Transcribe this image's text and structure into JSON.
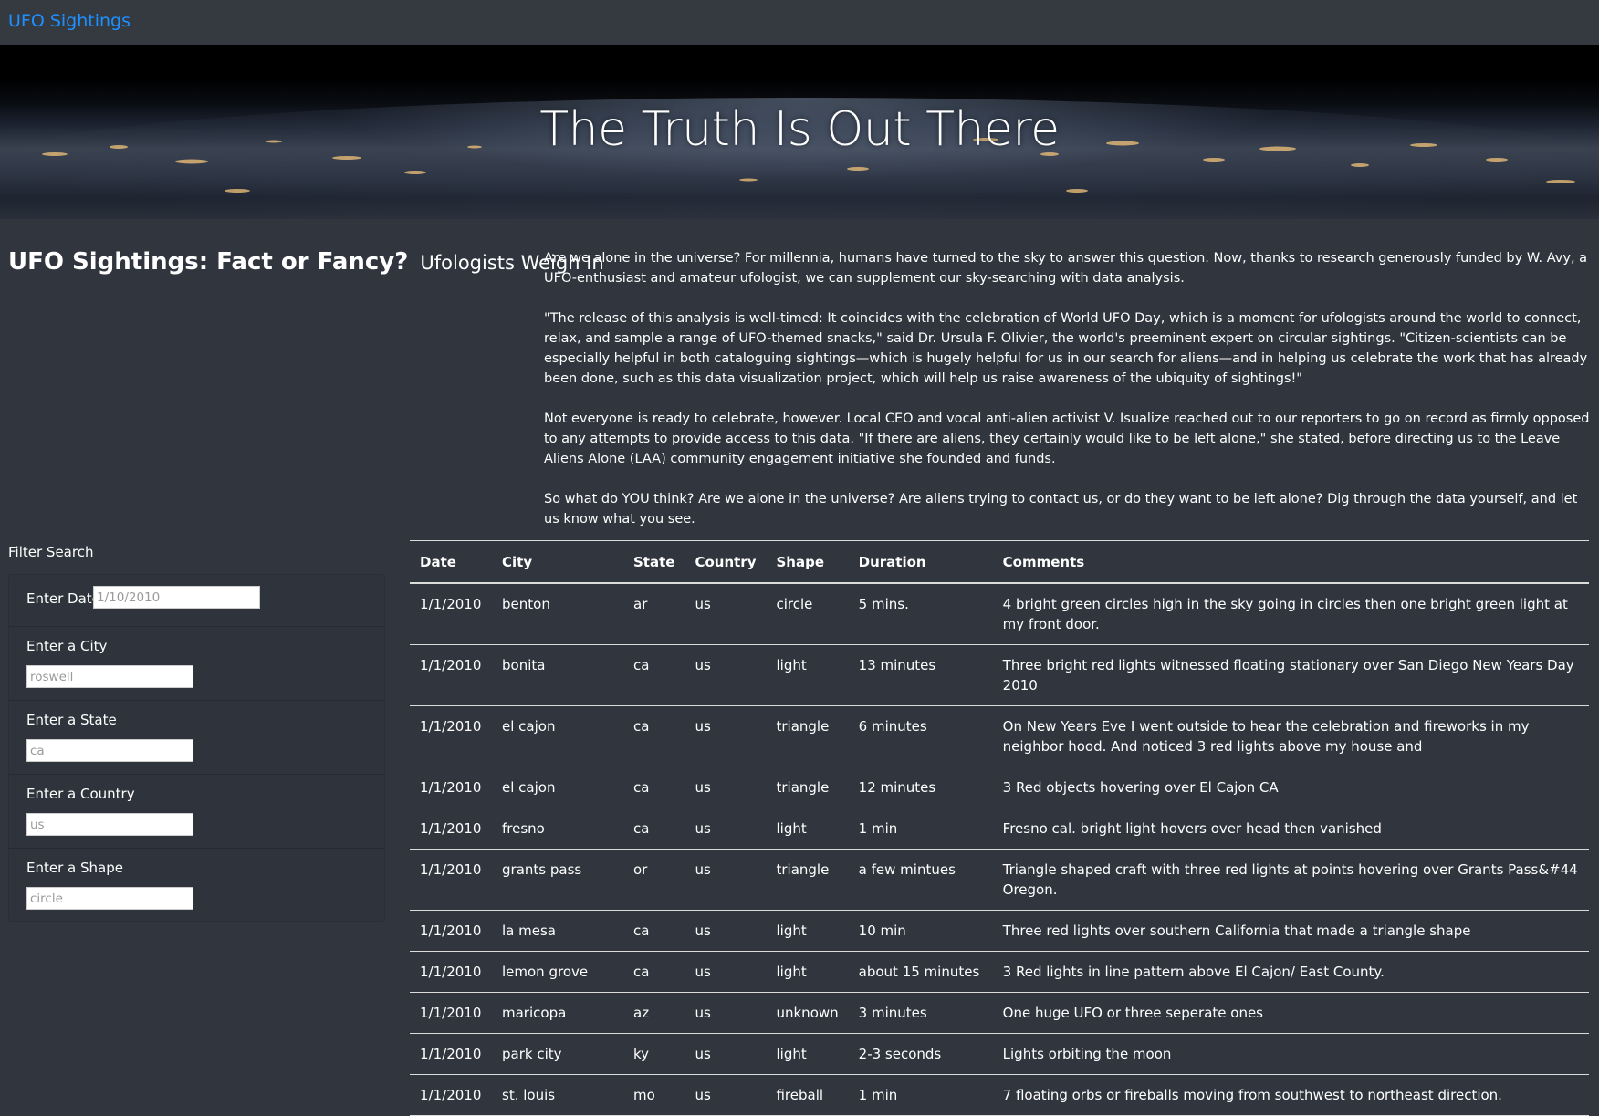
{
  "navbar": {
    "brand": "UFO Sightings"
  },
  "hero": {
    "title": "The Truth Is Out There"
  },
  "heading": {
    "title": "UFO Sightings: Fact or Fancy?",
    "subtitle": "Ufologists Weigh In"
  },
  "intro": {
    "paragraphs": [
      "Are we alone in the universe? For millennia, humans have turned to the sky to answer this question. Now, thanks to research generously funded by W. Avy, a UFO-enthusiast and amateur ufologist, we can supplement our sky-searching with data analysis.",
      "\"The release of this analysis is well-timed: It coincides with the celebration of World UFO Day, which is a moment for ufologists around the world to connect, relax, and sample a range of UFO-themed snacks,\" said Dr. Ursula F. Olivier, the world's preeminent expert on circular sightings. \"Citizen-scientists can be especially helpful in both cataloguing sightings—which is hugely helpful for us in our search for aliens—and in helping us celebrate the work that has already been done, such as this data visualization project, which will help us raise awareness of the ubiquity of sightings!\"",
      "Not everyone is ready to celebrate, however. Local CEO and vocal anti-alien activist V. Isualize reached out to our reporters to go on record as firmly opposed to any attempts to provide access to this data. \"If there are aliens, they certainly would like to be left alone,\" she stated, before directing us to the Leave Aliens Alone (LAA) community engagement initiative she founded and funds.",
      "So what do YOU think? Are we alone in the universe? Are aliens trying to contact us, or do they want to be left alone? Dig through the data yourself, and let us know what you see."
    ]
  },
  "filters": {
    "title": "Filter Search",
    "date": {
      "label": "Enter Date",
      "placeholder": "1/10/2010"
    },
    "city": {
      "label": "Enter a City",
      "placeholder": "roswell"
    },
    "state": {
      "label": "Enter a State",
      "placeholder": "ca"
    },
    "country": {
      "label": "Enter a Country",
      "placeholder": "us"
    },
    "shape": {
      "label": "Enter a Shape",
      "placeholder": "circle"
    }
  },
  "table": {
    "headers": [
      "Date",
      "City",
      "State",
      "Country",
      "Shape",
      "Duration",
      "Comments"
    ],
    "rows": [
      [
        "1/1/2010",
        "benton",
        "ar",
        "us",
        "circle",
        "5 mins.",
        "4 bright green circles high in the sky going in circles then one bright green light at my front door."
      ],
      [
        "1/1/2010",
        "bonita",
        "ca",
        "us",
        "light",
        "13 minutes",
        "Three bright red lights witnessed floating stationary over San Diego New Years Day 2010"
      ],
      [
        "1/1/2010",
        "el cajon",
        "ca",
        "us",
        "triangle",
        "6 minutes",
        "On New Years Eve I went outside to hear the celebration and fireworks in my neighbor hood. And noticed 3 red lights above my house and"
      ],
      [
        "1/1/2010",
        "el cajon",
        "ca",
        "us",
        "triangle",
        "12 minutes",
        "3 Red objects hovering over El Cajon CA"
      ],
      [
        "1/1/2010",
        "fresno",
        "ca",
        "us",
        "light",
        "1 min",
        "Fresno cal. bright light hovers over head then vanished"
      ],
      [
        "1/1/2010",
        "grants pass",
        "or",
        "us",
        "triangle",
        "a few mintues",
        "Triangle shaped craft with three red lights at points hovering over Grants Pass&#44 Oregon."
      ],
      [
        "1/1/2010",
        "la mesa",
        "ca",
        "us",
        "light",
        "10 min",
        "Three red lights over southern California that made a triangle shape"
      ],
      [
        "1/1/2010",
        "lemon grove",
        "ca",
        "us",
        "light",
        "about 15 minutes",
        "3 Red lights in line pattern above El Cajon/ East County."
      ],
      [
        "1/1/2010",
        "maricopa",
        "az",
        "us",
        "unknown",
        "3 minutes",
        "One huge UFO or three seperate ones"
      ],
      [
        "1/1/2010",
        "park city",
        "ky",
        "us",
        "light",
        "2-3 seconds",
        "Lights orbiting the moon"
      ],
      [
        "1/1/2010",
        "st. louis",
        "mo",
        "us",
        "fireball",
        "1 min",
        "7 floating orbs or fireballs moving from southwest to northeast direction."
      ]
    ]
  }
}
